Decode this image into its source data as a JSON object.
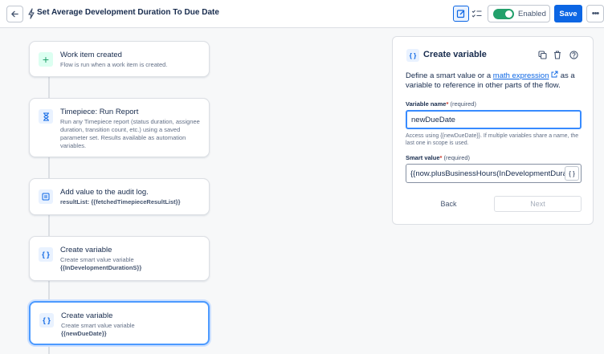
{
  "header": {
    "title": "Set Average Development Duration To Due Date",
    "enabled_label": "Enabled",
    "save_label": "Save",
    "more_label": "•••",
    "toggle_on": true
  },
  "flow": {
    "nodes": [
      {
        "icon": "plus-icon",
        "glyph": "+",
        "title": "Work item created",
        "desc": "Flow is run when a work item is created."
      },
      {
        "icon": "hourglass-icon",
        "glyph": "⏳",
        "title": "Timepiece: Run Report",
        "desc": "Run any Timepiece report (status duration, assignee duration, transition count, etc.) using a saved parameter set. Results available as automation variables."
      },
      {
        "icon": "audit-log-icon",
        "glyph": "≣",
        "title": "Add value to the audit log.",
        "desc_prefix": "resultList:",
        "desc_value": "{{fetchedTimepieceResultList}}"
      },
      {
        "icon": "braces-icon",
        "glyph": "{ }",
        "title": "Create variable",
        "desc": "Create smart value variable",
        "desc_value": "{{InDevelopmentDurationS}}"
      },
      {
        "icon": "braces-icon",
        "glyph": "{ }",
        "title": "Create variable",
        "desc": "Create smart value variable",
        "desc_value": "{{newDueDate}}"
      }
    ]
  },
  "panel": {
    "icon_glyph": "{ }",
    "title": "Create variable",
    "desc_before": "Define a smart value or a ",
    "desc_link": "math expression",
    "desc_after": " as a variable to reference in other parts of the flow.",
    "var_label": "Variable name",
    "required_star": "*",
    "required_text": "(required)",
    "var_value": "newDueDate",
    "help_text": "Access using {{newDueDate}}. If multiple variables share a name, the last one in scope is used.",
    "smart_label": "Smart value",
    "smart_value": "{{now.plusBusinessHours(InDevelopmentDuration",
    "brace_btn": "{ }",
    "back_label": "Back",
    "next_label": "Next"
  },
  "colors": {
    "accent": "#0c66e4",
    "toggle": "#22a06b",
    "selected_border": "#4c9aff"
  }
}
